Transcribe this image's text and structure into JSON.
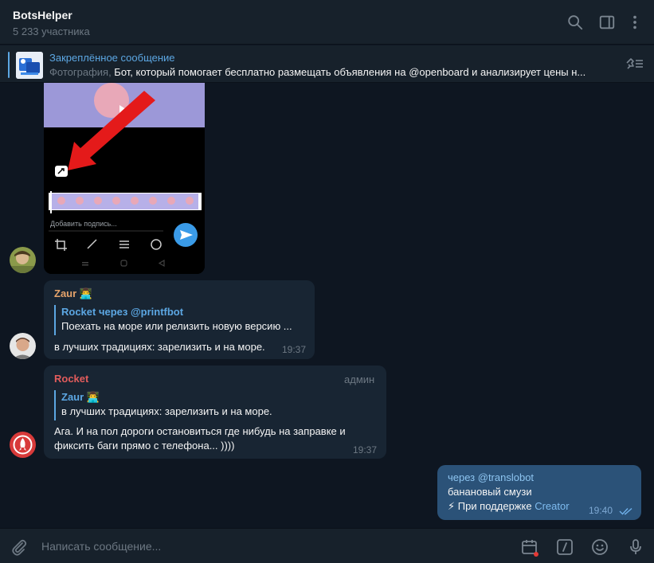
{
  "header": {
    "title": "BotsHelper",
    "subtitle": "5 233 участника"
  },
  "pinned": {
    "title": "Закреплённое сообщение",
    "prefix": "Фотография, ",
    "text": "Бот, который помогает бесплатно размещать объявления на @openboard и анализирует цены н..."
  },
  "photo_message": {
    "caption_placeholder": "Добавить подпись..."
  },
  "messages": [
    {
      "sender": "Zaur",
      "reply_name": "Rocket через @printfbot",
      "reply_text": "Поехать на море или релизить новую версию ...",
      "text": "в лучших традициях: зарелизить и на море.",
      "time": "19:37"
    },
    {
      "sender": "Rocket",
      "role": "админ",
      "reply_name": "Zaur",
      "reply_text": "в лучших традициях: зарелизить и на море.",
      "text_line1": "Ага. И на пол дороги остановиться где нибудь на заправке и",
      "text_line2": "фиксить баги прямо с телефона... ))))",
      "time": "19:37"
    }
  ],
  "outgoing": {
    "via": "через @translobot",
    "text": "банановый смузи",
    "footer_prefix": "⚡ При поддержке ",
    "footer_link": "Creator",
    "time": "19:40"
  },
  "composer": {
    "placeholder": "Написать сообщение..."
  },
  "colors": {
    "background": "#0e1621",
    "panel": "#17212b",
    "bubble_in": "#182533",
    "bubble_out": "#2b5278",
    "accent": "#5ca7e3",
    "zaur_name": "#e5a36b",
    "rocket_name": "#e25c5c"
  },
  "icons": [
    "search-icon",
    "sidebar-toggle-icon",
    "more-vertical-icon",
    "unpin-list-icon",
    "attach-icon",
    "schedule-icon",
    "bot-commands-icon",
    "emoji-icon",
    "microphone-icon"
  ]
}
